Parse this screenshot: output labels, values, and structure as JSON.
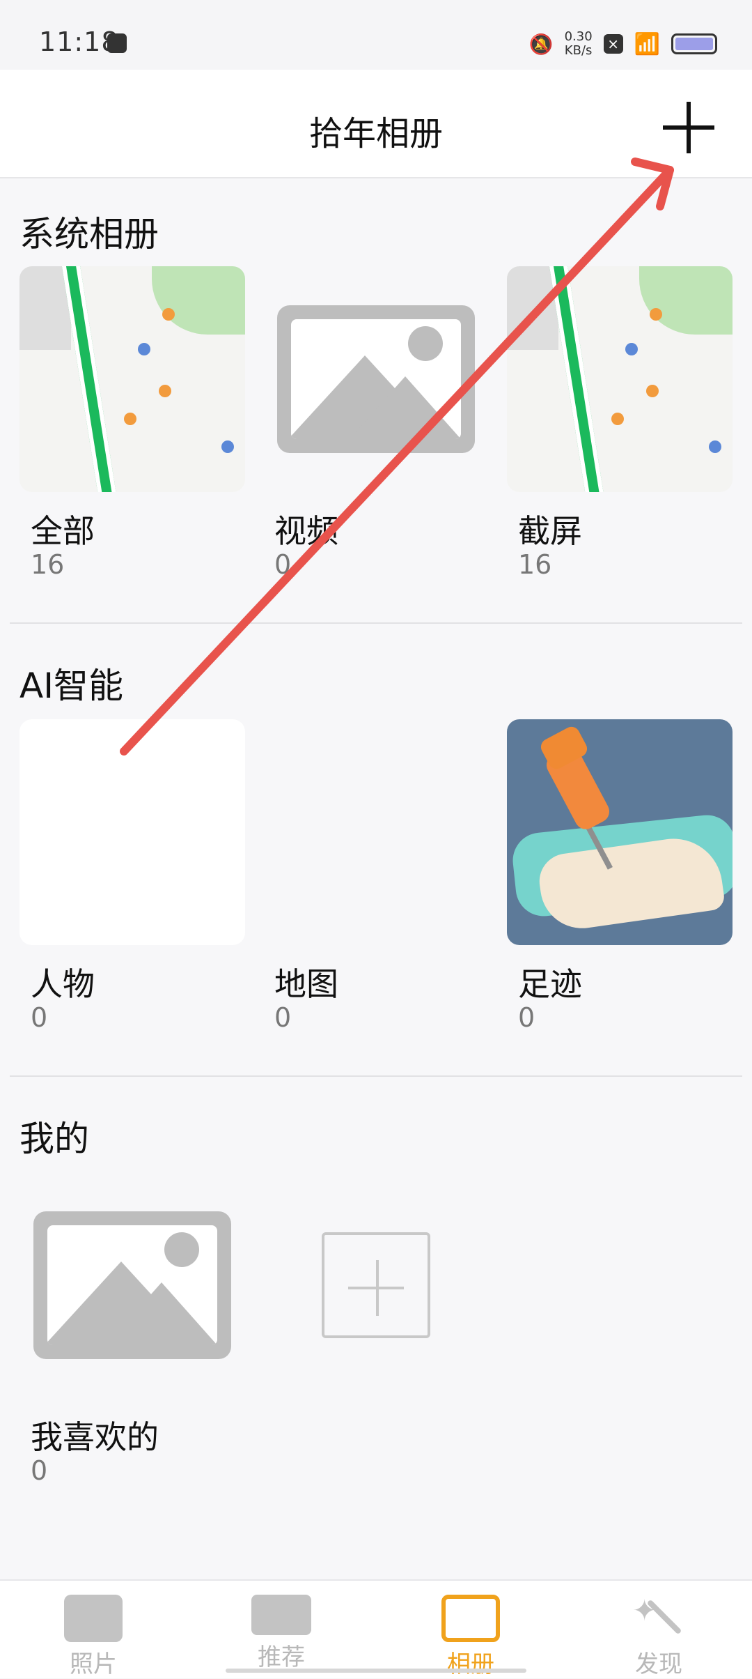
{
  "status_bar": {
    "time": "11:18",
    "network_rate_value": "0.30",
    "network_rate_unit": "KB/s",
    "battery_color": "#9c9ee8"
  },
  "header": {
    "title": "拾年相册",
    "add_icon": "plus-icon"
  },
  "sections": {
    "system": {
      "title": "系统相册",
      "items": [
        {
          "label": "全部",
          "count": "16",
          "thumb": "map-thumbnail"
        },
        {
          "label": "视频",
          "count": "0",
          "thumb": "image-placeholder-icon"
        },
        {
          "label": "截屏",
          "count": "16",
          "thumb": "map-thumbnail"
        }
      ]
    },
    "ai": {
      "title": "AI智能",
      "items": [
        {
          "label": "人物",
          "count": "0",
          "thumb": "blank-thumbnail"
        },
        {
          "label": "地图",
          "count": "0",
          "thumb": "none"
        },
        {
          "label": "足迹",
          "count": "0",
          "thumb": "pushpin-map-thumbnail"
        }
      ]
    },
    "mine": {
      "title": "我的",
      "items": [
        {
          "label": "我喜欢的",
          "count": "0",
          "thumb": "image-placeholder-icon"
        }
      ],
      "add_label": "plus-icon"
    }
  },
  "tabbar": {
    "tabs": [
      {
        "label": "照片",
        "icon": "photo-icon",
        "active": false
      },
      {
        "label": "推荐",
        "icon": "clapperboard-icon",
        "active": false
      },
      {
        "label": "相册",
        "icon": "folder-icon",
        "active": true
      },
      {
        "label": "发现",
        "icon": "magic-wand-icon",
        "active": false
      }
    ],
    "active_color": "#f0a21c",
    "inactive_color": "#b8b8b8"
  },
  "annotation": {
    "arrow_color": "#e8534c"
  }
}
